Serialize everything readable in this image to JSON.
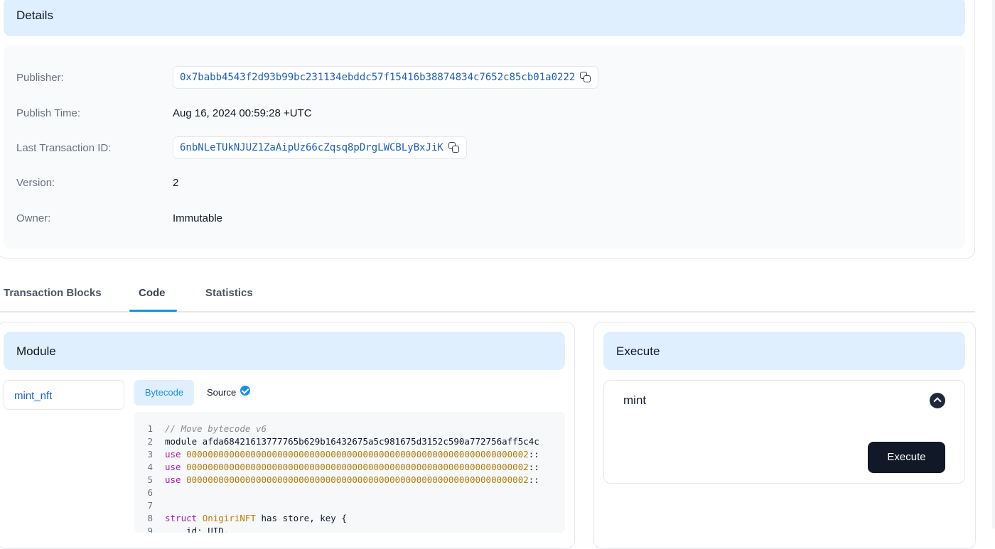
{
  "details": {
    "title": "Details",
    "rows": [
      {
        "label": "Publisher:",
        "value": "0x7babb4543f2d93b99bc231134ebddc57f15416b38874834c7652c85cb01a0222"
      },
      {
        "label": "Publish Time:",
        "value": "Aug 16, 2024 00:59:28 +UTC"
      },
      {
        "label": "Last Transaction ID:",
        "value": "6nbNLeTUkNJUZ1ZaAipUz66cZqsq8pDrgLWCBLyBxJiK"
      },
      {
        "label": "Version:",
        "value": "2"
      },
      {
        "label": "Owner:",
        "value": "Immutable"
      }
    ]
  },
  "tabs": [
    {
      "label": "Transaction Blocks",
      "active": false
    },
    {
      "label": "Code",
      "active": true
    },
    {
      "label": "Statistics",
      "active": false
    }
  ],
  "module": {
    "title": "Module",
    "selected": "mint_nft",
    "view_tabs": {
      "bytecode": "Bytecode",
      "source": "Source"
    },
    "code_lines": [
      {
        "num": "1",
        "parts": [
          {
            "t": "// Move bytecode v6",
            "c": "c-comment"
          }
        ]
      },
      {
        "num": "2",
        "parts": [
          {
            "t": "module afda68421613777765b629b16432675a5c981675d3152c590a772756aff5c4c",
            "c": ""
          }
        ]
      },
      {
        "num": "3",
        "parts": [
          {
            "t": "use ",
            "c": "c-kw"
          },
          {
            "t": "0000000000000000000000000000000000000000000000000000000000000002",
            "c": "c-addr"
          },
          {
            "t": "::",
            "c": ""
          }
        ]
      },
      {
        "num": "4",
        "parts": [
          {
            "t": "use ",
            "c": "c-kw"
          },
          {
            "t": "0000000000000000000000000000000000000000000000000000000000000002",
            "c": "c-addr"
          },
          {
            "t": "::",
            "c": ""
          }
        ]
      },
      {
        "num": "5",
        "parts": [
          {
            "t": "use ",
            "c": "c-kw"
          },
          {
            "t": "0000000000000000000000000000000000000000000000000000000000000002",
            "c": "c-addr"
          },
          {
            "t": "::",
            "c": ""
          }
        ]
      },
      {
        "num": "6",
        "parts": []
      },
      {
        "num": "7",
        "parts": []
      },
      {
        "num": "8",
        "parts": [
          {
            "t": "struct ",
            "c": "c-kw"
          },
          {
            "t": "OnigiriNFT",
            "c": "c-type"
          },
          {
            "t": " has store, key {",
            "c": ""
          }
        ]
      },
      {
        "num": "9",
        "parts": [
          {
            "t": "    id: UID,",
            "c": ""
          }
        ]
      }
    ]
  },
  "execute": {
    "title": "Execute",
    "function_name": "mint",
    "button_label": "Execute"
  },
  "colors": {
    "accent": "#1d8fe0",
    "header_bg": "#e0effe",
    "link": "#1d5fb8",
    "dark_button": "#111827"
  }
}
